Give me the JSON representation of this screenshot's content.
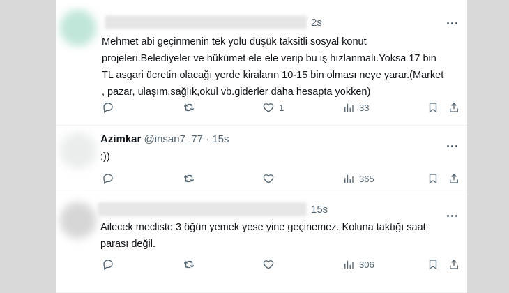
{
  "tweets": [
    {
      "author": "",
      "handle": "",
      "time": "2s",
      "text": "Mehmet abi geçinmenin tek yolu düşük taksitli  sosyal konut\nprojeleri.Belediyeler ve hükümet ele ele verip bu iş hızlanmalı.Yoksa 17 bin\nTL asgari ücretin olacağı yerde kiraların 10-15 bin olması neye yarar.(Market\n, pazar, ulaşım,sağlık,okul vb.giderler daha hesapta yokken)",
      "likes": "1",
      "views": "33"
    },
    {
      "author": "Azimkar",
      "handle": "@insan7_77",
      "separator": "·",
      "time": "15s",
      "text": ":))",
      "likes": "",
      "views": "365"
    },
    {
      "author": "",
      "handle": "",
      "time": "15s",
      "text": "Ailecek mecliste 3 öğün yemek yese yine geçinemez. Koluna taktığı saat\nparası değil.",
      "likes": "",
      "views": "306"
    }
  ],
  "icons": {
    "reply": "reply-icon",
    "retweet": "retweet-icon",
    "like": "heart-icon",
    "views": "views-icon",
    "bookmark": "bookmark-icon",
    "share": "share-icon",
    "more": "more-icon"
  },
  "colors": {
    "text": "#0f1419",
    "secondary": "#536471",
    "divider": "#eff3f4",
    "background": "#ffffff"
  }
}
